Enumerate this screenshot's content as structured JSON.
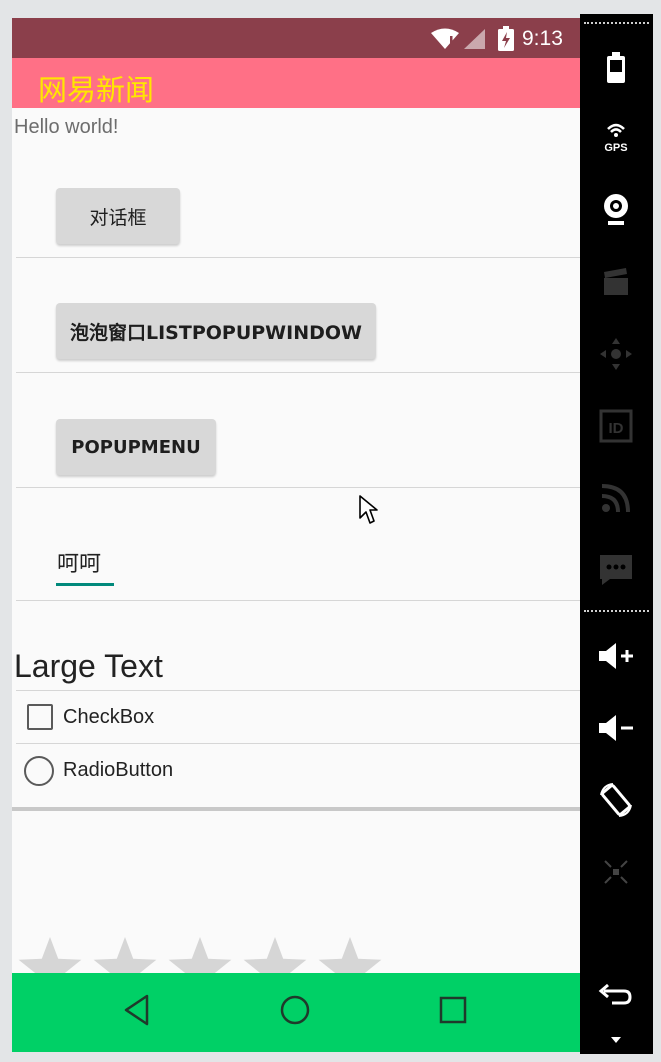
{
  "status_bar": {
    "time": "9:13"
  },
  "action_bar": {
    "title": "网易新闻",
    "title_color": "#ffe600",
    "background": "#ff7086"
  },
  "content": {
    "hello_text": "Hello world!",
    "dialog_button": "对话框",
    "list_popup_button": "泡泡窗口LISTPOPUPWINDOW",
    "popup_menu_button": "POPUPMENU",
    "edit_text_value": "呵呵",
    "large_text": "Large Text",
    "checkbox_label": "CheckBox",
    "radio_label": "RadioButton",
    "rating_stars": 5
  },
  "nav_bar": {
    "background": "#00d066",
    "icons": [
      "back-icon",
      "home-icon",
      "recent-apps-icon"
    ]
  },
  "side_toolbar": {
    "icons": [
      "battery-icon",
      "gps-icon",
      "camera-icon",
      "clapper-icon",
      "dpad-icon",
      "id-icon",
      "rss-icon",
      "sms-icon",
      "volume-up-icon",
      "volume-down-icon",
      "rotate-icon",
      "zoom-icon",
      "back-icon"
    ],
    "gps_label": "GPS",
    "id_label": "ID"
  }
}
